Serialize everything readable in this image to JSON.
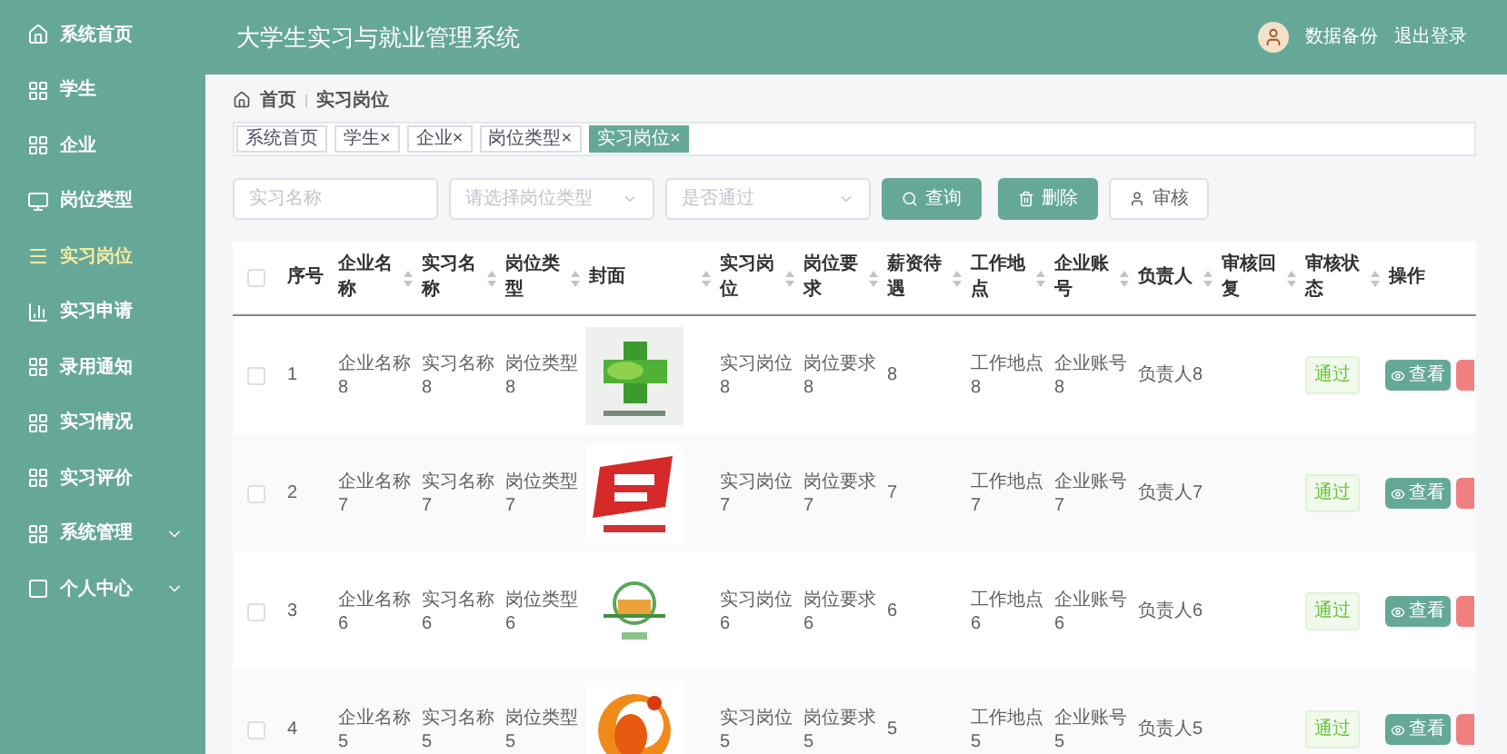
{
  "app_title": "大学生实习与就业管理系统",
  "header_links": [
    "数据备份",
    "退出登录"
  ],
  "sidebar": {
    "items": [
      {
        "label": "系统首页",
        "selected": false,
        "expandable": false
      },
      {
        "label": "学生",
        "selected": false,
        "expandable": false
      },
      {
        "label": "企业",
        "selected": false,
        "expandable": false
      },
      {
        "label": "岗位类型",
        "selected": false,
        "expandable": false
      },
      {
        "label": "实习岗位",
        "selected": true,
        "expandable": false
      },
      {
        "label": "实习申请",
        "selected": false,
        "expandable": false
      },
      {
        "label": "录用通知",
        "selected": false,
        "expandable": false
      },
      {
        "label": "实习情况",
        "selected": false,
        "expandable": false
      },
      {
        "label": "实习评价",
        "selected": false,
        "expandable": false
      },
      {
        "label": "系统管理",
        "selected": false,
        "expandable": true
      },
      {
        "label": "个人中心",
        "selected": false,
        "expandable": true
      }
    ]
  },
  "breadcrumb": [
    "首页",
    "实习岗位"
  ],
  "tags": [
    {
      "label": "系统首页",
      "closable": false,
      "selected": false
    },
    {
      "label": "学生",
      "closable": true,
      "selected": false
    },
    {
      "label": "企业",
      "closable": true,
      "selected": false
    },
    {
      "label": "岗位类型",
      "closable": true,
      "selected": false
    },
    {
      "label": "实习岗位",
      "closable": true,
      "selected": true
    }
  ],
  "close_mark": "×",
  "filters": [
    {
      "kind": "input",
      "placeholder": "实习名称"
    },
    {
      "kind": "select",
      "placeholder": "请选择岗位类型"
    },
    {
      "kind": "select",
      "placeholder": "是否通过"
    }
  ],
  "buttons": [
    {
      "label": "查询",
      "kind": "search"
    },
    {
      "label": "删除",
      "kind": "delete"
    },
    {
      "label": "审核",
      "kind": "audit"
    }
  ],
  "table": {
    "columns": [
      {
        "label": "序号",
        "sortable": false
      },
      {
        "label": "企业名称",
        "sortable": true
      },
      {
        "label": "实习名称",
        "sortable": true
      },
      {
        "label": "岗位类型",
        "sortable": true
      },
      {
        "label": "封面",
        "sortable": true
      },
      {
        "label": "实习岗位",
        "sortable": true
      },
      {
        "label": "岗位要求",
        "sortable": true
      },
      {
        "label": "薪资待遇",
        "sortable": true
      },
      {
        "label": "工作地点",
        "sortable": true
      },
      {
        "label": "企业账号",
        "sortable": true
      },
      {
        "label": "负责人",
        "sortable": true
      },
      {
        "label": "审核回复",
        "sortable": true
      },
      {
        "label": "审核状态",
        "sortable": true
      },
      {
        "label": "操作",
        "sortable": false
      }
    ],
    "all_selected": false,
    "rows": [
      {
        "selected": false,
        "cells": [
          "1",
          "企业名称8",
          "实习名称8",
          "岗位类型8",
          {
            "kind": "picture"
          },
          "实习岗位8",
          "岗位要求8",
          "8",
          "工作地点8",
          "企业账号8",
          "负责人8",
          "",
          {
            "kind": "status",
            "label": "通过"
          },
          {
            "kind": "actions",
            "label": "查看"
          }
        ]
      },
      {
        "selected": false,
        "cells": [
          "2",
          "企业名称7",
          "实习名称7",
          "岗位类型7",
          {
            "kind": "picture"
          },
          "实习岗位7",
          "岗位要求7",
          "7",
          "工作地点7",
          "企业账号7",
          "负责人7",
          "",
          {
            "kind": "status",
            "label": "通过"
          },
          {
            "kind": "actions",
            "label": "查看"
          }
        ]
      },
      {
        "selected": false,
        "cells": [
          "3",
          "企业名称6",
          "实习名称6",
          "岗位类型6",
          {
            "kind": "picture"
          },
          "实习岗位6",
          "岗位要求6",
          "6",
          "工作地点6",
          "企业账号6",
          "负责人6",
          "",
          {
            "kind": "status",
            "label": "通过"
          },
          {
            "kind": "actions",
            "label": "查看"
          }
        ]
      },
      {
        "selected": false,
        "cells": [
          "4",
          "企业名称5",
          "实习名称5",
          "岗位类型5",
          {
            "kind": "picture"
          },
          "实习岗位5",
          "岗位要求5",
          "5",
          "工作地点5",
          "企业账号5",
          "负责人5",
          "",
          {
            "kind": "status",
            "label": "通过"
          },
          {
            "kind": "actions",
            "label": "查看"
          }
        ]
      }
    ]
  }
}
